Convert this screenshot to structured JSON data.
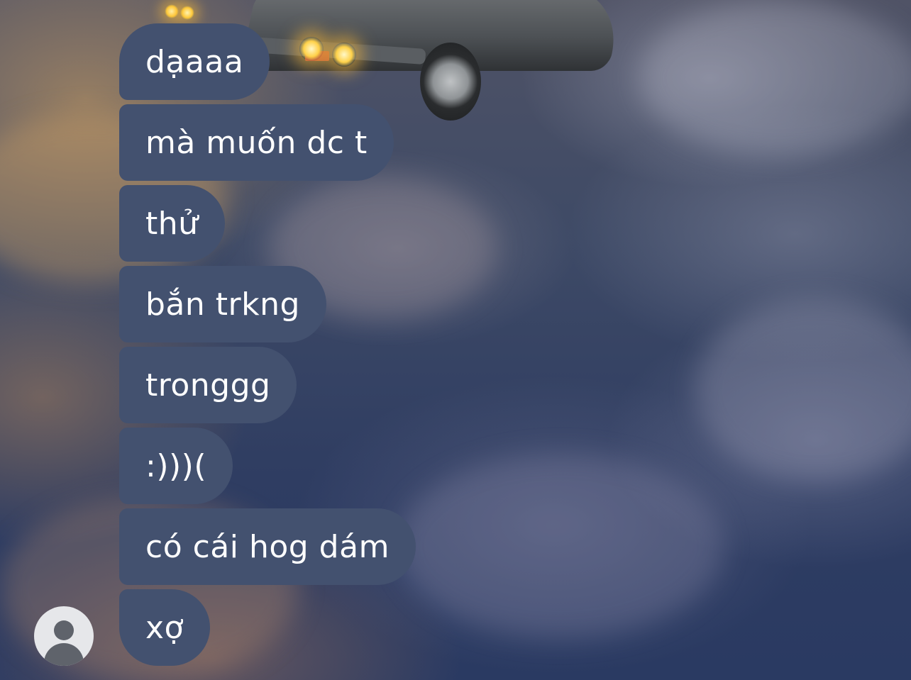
{
  "conversation": {
    "messages": [
      {
        "text": "dạaaa"
      },
      {
        "text": "mà muốn dc t"
      },
      {
        "text": "thử"
      },
      {
        "text": "bắn trkng"
      },
      {
        "text": "tronggg"
      },
      {
        "text": ":)))("
      },
      {
        "text": "có cái hog dám"
      },
      {
        "text": "xợ"
      }
    ]
  },
  "colors": {
    "bubble_background": "#43516f",
    "bubble_text": "#ffffff",
    "avatar_background": "#e6e7ea",
    "avatar_icon": "#5f636b"
  },
  "icons": {
    "sender_avatar": "default-user-avatar-icon"
  }
}
